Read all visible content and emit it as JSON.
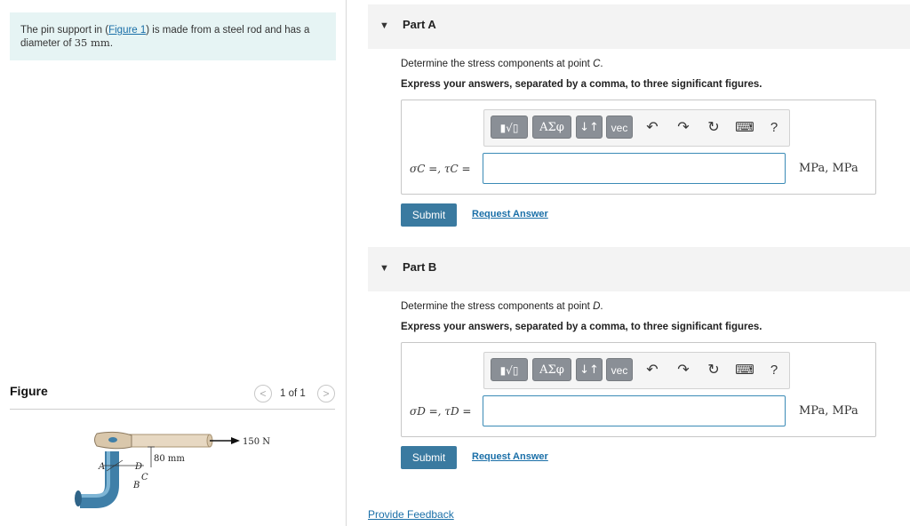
{
  "problem": {
    "text_before": "The pin support in (",
    "figure_link": "Figure 1",
    "text_after": ") is made from a steel rod and has a diameter of ",
    "diameter": "35 mm",
    "text_end": "."
  },
  "figure": {
    "title": "Figure",
    "prev_icon": "<",
    "next_icon": ">",
    "page_count": "1 of 1",
    "labels": {
      "force": "150 N",
      "distance": "80 mm",
      "A": "A",
      "B": "B",
      "C": "C",
      "D": "D"
    }
  },
  "parts": [
    {
      "caret": "▼",
      "title": "Part A",
      "question_prefix": "Determine the stress components at point ",
      "point": "C",
      "question_suffix": ".",
      "instruction": "Express your answers, separated by a comma, to three significant figures.",
      "equation_label": "σC =, τC =",
      "input_value": "",
      "units": "MPa, MPa",
      "submit": "Submit",
      "request": "Request Answer"
    },
    {
      "caret": "▼",
      "title": "Part B",
      "question_prefix": "Determine the stress components at point ",
      "point": "D",
      "question_suffix": ".",
      "instruction": "Express your answers, separated by a comma, to three significant figures.",
      "equation_label": "σD =, τD =",
      "input_value": "",
      "units": "MPa, MPa",
      "submit": "Submit",
      "request": "Request Answer"
    }
  ],
  "toolbar": {
    "template_icon": "▮√▯",
    "greek": "ΑΣφ",
    "arrows": "↓↑",
    "vec": "vec",
    "undo_icon": "↶",
    "redo_icon": "↷",
    "reset_icon": "↻",
    "keyboard_icon": "⌨",
    "help": "?"
  },
  "feedback": "Provide Feedback",
  "colors": {
    "problem_bg": "#e6f4f4",
    "accent": "#3a7aa0",
    "link": "#1a6fa8",
    "part_header_bg": "#f3f3f3"
  }
}
